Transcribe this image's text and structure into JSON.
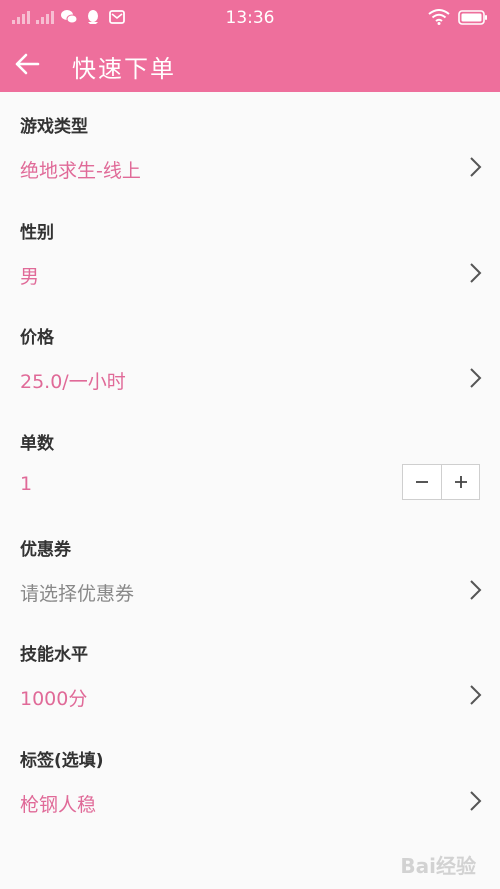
{
  "status_bar": {
    "time": "13:36",
    "signal_label": "4G",
    "icons": [
      "signal-icon",
      "wechat-icon",
      "qq-icon",
      "mail-icon",
      "wifi-icon",
      "battery-icon"
    ]
  },
  "header": {
    "title": "快速下单",
    "accent_color": "#ee6f9c"
  },
  "form": {
    "fields": [
      {
        "label": "游戏类型",
        "value": "绝地求生-线上"
      },
      {
        "label": "性别",
        "value": "男"
      },
      {
        "label": "价格",
        "value": "25.0/一小时"
      },
      {
        "label": "单数",
        "value": "1"
      },
      {
        "label": "优惠券",
        "value": "请选择优惠券"
      },
      {
        "label": "技能水平",
        "value": "1000分"
      },
      {
        "label": "标签(选填)",
        "value": "枪钢人稳"
      }
    ],
    "stepper": {
      "minus": "−",
      "plus": "+"
    }
  },
  "watermark": "Bai经验"
}
